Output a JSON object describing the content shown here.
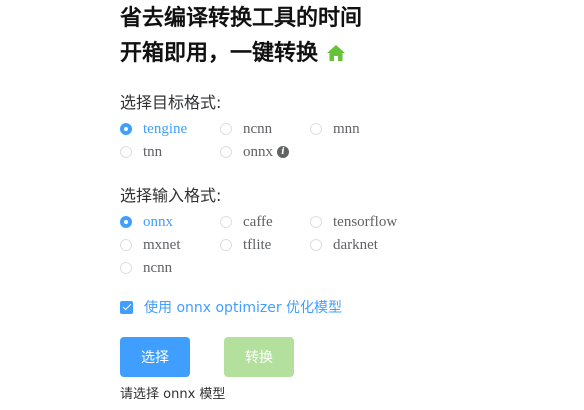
{
  "header": {
    "line1": "省去编译转换工具的时间",
    "line2": "开箱即用，一键转换",
    "icon": "home-icon",
    "icon_color": "#67c23a"
  },
  "target_format": {
    "label": "选择目标格式:",
    "selected": "tengine",
    "options": [
      {
        "label": "tengine",
        "checked": true
      },
      {
        "label": "ncnn",
        "checked": false
      },
      {
        "label": "mnn",
        "checked": false
      },
      {
        "label": "tnn",
        "checked": false
      },
      {
        "label": "onnx",
        "checked": false,
        "icon": "info-icon"
      }
    ]
  },
  "input_format": {
    "label": "选择输入格式:",
    "selected": "onnx",
    "options": [
      {
        "label": "onnx",
        "checked": true
      },
      {
        "label": "caffe",
        "checked": false
      },
      {
        "label": "tensorflow",
        "checked": false
      },
      {
        "label": "mxnet",
        "checked": false
      },
      {
        "label": "tflite",
        "checked": false
      },
      {
        "label": "darknet",
        "checked": false
      },
      {
        "label": "ncnn",
        "checked": false
      }
    ]
  },
  "optimizer": {
    "label": "使用 onnx optimizer 优化模型",
    "checked": true
  },
  "buttons": {
    "select": "选择",
    "convert": "转换",
    "convert_disabled": true
  },
  "status": "请选择 onnx 模型",
  "colors": {
    "primary": "#409eff",
    "success_disabled": "#b3e19d",
    "text": "#303133"
  }
}
